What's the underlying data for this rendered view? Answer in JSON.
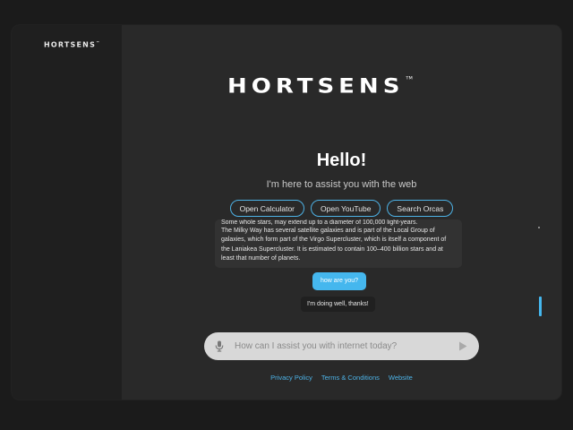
{
  "sidebar": {
    "logo": "HORTSENS",
    "logo_tm": "™"
  },
  "header": {
    "brand": "HORTSENS",
    "brand_tm": "TM"
  },
  "welcome": {
    "title": "Hello!",
    "subtitle": "I'm here to assist you with the web"
  },
  "quick_actions": [
    {
      "label": "Open Calculator"
    },
    {
      "label": "Open YouTube"
    },
    {
      "label": "Search Orcas"
    }
  ],
  "chat": {
    "messages": [
      {
        "role": "assistant",
        "text_cut": "Some whole stars, may extend up to a diameter of 100,000 light-years.",
        "text": "The Milky Way has several satellite galaxies and is part of the Local Group of galaxies, which form part of the Virgo Supercluster, which is itself a component of the Laniakea Supercluster. It is estimated to contain 100–400 billion stars and at least that number of planets."
      },
      {
        "role": "user",
        "text": "how are you?"
      },
      {
        "role": "assistant",
        "text": "I'm doing well, thanks!"
      }
    ]
  },
  "input": {
    "placeholder": "How can I assist you with internet today?",
    "value": ""
  },
  "footer": {
    "links": [
      {
        "label": "Privacy Policy"
      },
      {
        "label": "Terms & Conditions"
      },
      {
        "label": "Website"
      }
    ]
  },
  "colors": {
    "accent": "#45b7ee",
    "background": "#292929",
    "sidebar": "#1f1f1f",
    "page": "#1b1b1b"
  },
  "icons": {
    "mic": "microphone-icon",
    "send": "send-icon"
  }
}
